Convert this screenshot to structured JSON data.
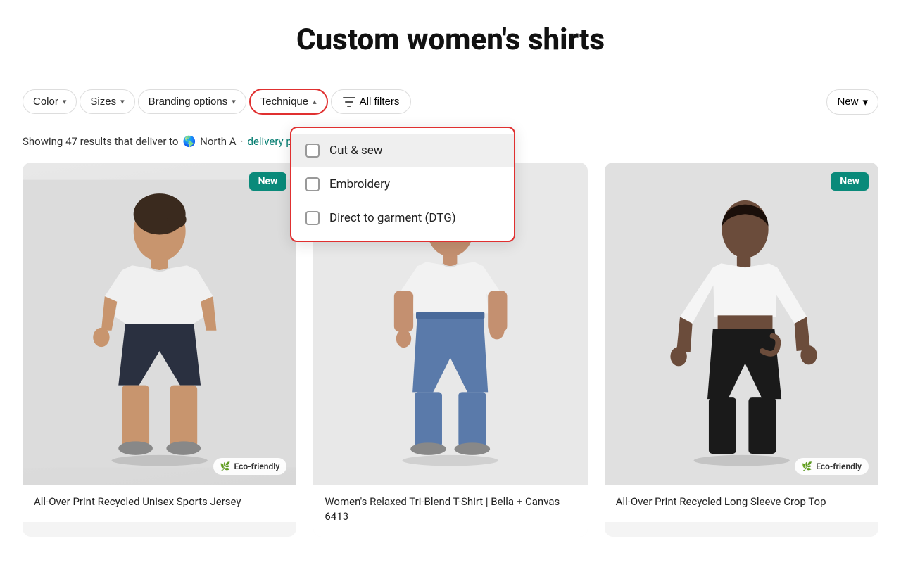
{
  "page": {
    "title": "Custom women's shirts"
  },
  "filters": {
    "color_label": "Color",
    "sizes_label": "Sizes",
    "branding_label": "Branding options",
    "technique_label": "Technique",
    "all_filters_label": "All filters",
    "sort_label": "New"
  },
  "technique_dropdown": {
    "items": [
      {
        "id": "cut-sew",
        "label": "Cut & sew",
        "checked": false,
        "highlighted": true
      },
      {
        "id": "embroidery",
        "label": "Embroidery",
        "checked": false,
        "highlighted": false
      },
      {
        "id": "dtg",
        "label": "Direct to garment (DTG)",
        "checked": false,
        "highlighted": false
      }
    ]
  },
  "results": {
    "text": "Showing 47 results that deliver to",
    "location": "North A",
    "delivery_link": "delivery preferences"
  },
  "products": [
    {
      "id": 1,
      "name": "All-Over Print Recycled Unisex Sports Jersey",
      "is_new": true,
      "is_eco": true,
      "eco_label": "Eco-friendly",
      "bg": "#e2e2e2",
      "figure_type": "woman_shorts"
    },
    {
      "id": 2,
      "name": "Women's Relaxed Tri-Blend T-Shirt | Bella + Canvas 6413",
      "is_new": false,
      "is_eco": false,
      "eco_label": "",
      "bg": "#eaeaea",
      "figure_type": "woman_jeans"
    },
    {
      "id": 3,
      "name": "All-Over Print Recycled Long Sleeve Crop Top",
      "is_new": true,
      "is_eco": true,
      "eco_label": "Eco-friendly",
      "bg": "#e4e4e4",
      "figure_type": "woman_crop"
    }
  ],
  "icons": {
    "chevron_down": "▾",
    "chevron_up": "▴",
    "globe": "🌎",
    "leaf": "🌿",
    "info": "i"
  }
}
